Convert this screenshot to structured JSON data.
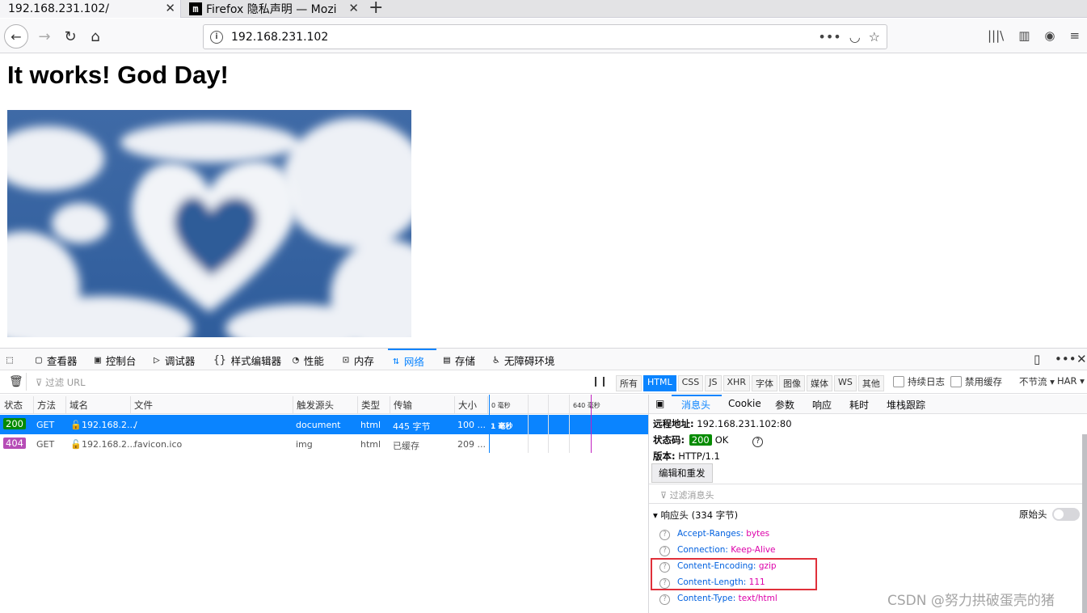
{
  "tabs": [
    {
      "title": "192.168.231.102/",
      "active": true
    },
    {
      "title": "Firefox 隐私声明 — Mozi",
      "active": false
    }
  ],
  "nav": {
    "url": "192.168.231.102"
  },
  "page": {
    "heading": "It works! God Day!"
  },
  "devtools": {
    "tabs": [
      "查看器",
      "控制台",
      "调试器",
      "样式编辑器",
      "性能",
      "内存",
      "网络",
      "存储",
      "无障碍环境"
    ],
    "filter_placeholder": "过滤 URL",
    "type_filters": [
      "所有",
      "HTML",
      "CSS",
      "JS",
      "XHR",
      "字体",
      "图像",
      "媒体",
      "WS",
      "其他"
    ],
    "persist_log": "持续日志",
    "disable_cache": "禁用缓存",
    "throttle": "不节流 ▾",
    "har": "HAR ▾",
    "columns": [
      "状态",
      "方法",
      "域名",
      "文件",
      "触发源头",
      "类型",
      "传输",
      "大小"
    ],
    "timeline_ticks": [
      "0 毫秒",
      "640 毫秒"
    ],
    "requests": [
      {
        "status": "200",
        "method": "GET",
        "domain": "192.168.2...",
        "file": "/",
        "cause": "document",
        "type": "html",
        "transferred": "445 字节",
        "size": "100 ...",
        "timing": "1 毫秒"
      },
      {
        "status": "404",
        "method": "GET",
        "domain": "192.168.2...",
        "file": "favicon.ico",
        "cause": "img",
        "type": "html",
        "transferred": "已缓存",
        "size": "209 ...",
        "timing": ""
      }
    ],
    "details": {
      "tabs": [
        "消息头",
        "Cookie",
        "参数",
        "响应",
        "耗时",
        "堆栈跟踪"
      ],
      "remote_label": "远程地址:",
      "remote_value": "192.168.231.102:80",
      "status_label": "状态码:",
      "status_code": "200",
      "status_text": "OK",
      "version_label": "版本:",
      "version_value": "HTTP/1.1",
      "resend": "编辑和重发",
      "filter_headers": "过滤消息头",
      "response_headers_title": "响应头 (334 字节)",
      "raw_headers": "原始头",
      "headers": [
        {
          "name": "Accept-Ranges:",
          "value": "bytes"
        },
        {
          "name": "Connection:",
          "value": "Keep-Alive"
        },
        {
          "name": "Content-Encoding:",
          "value": "gzip"
        },
        {
          "name": "Content-Length:",
          "value": "111"
        },
        {
          "name": "Content-Type:",
          "value": "text/html"
        }
      ]
    }
  },
  "watermark": "CSDN @努力拱破蛋壳的猪",
  "colors": {
    "accent": "#0a84ff",
    "status_ok": "#058b00",
    "status_404": "#b64cb6",
    "highlight": "#e0303a"
  }
}
